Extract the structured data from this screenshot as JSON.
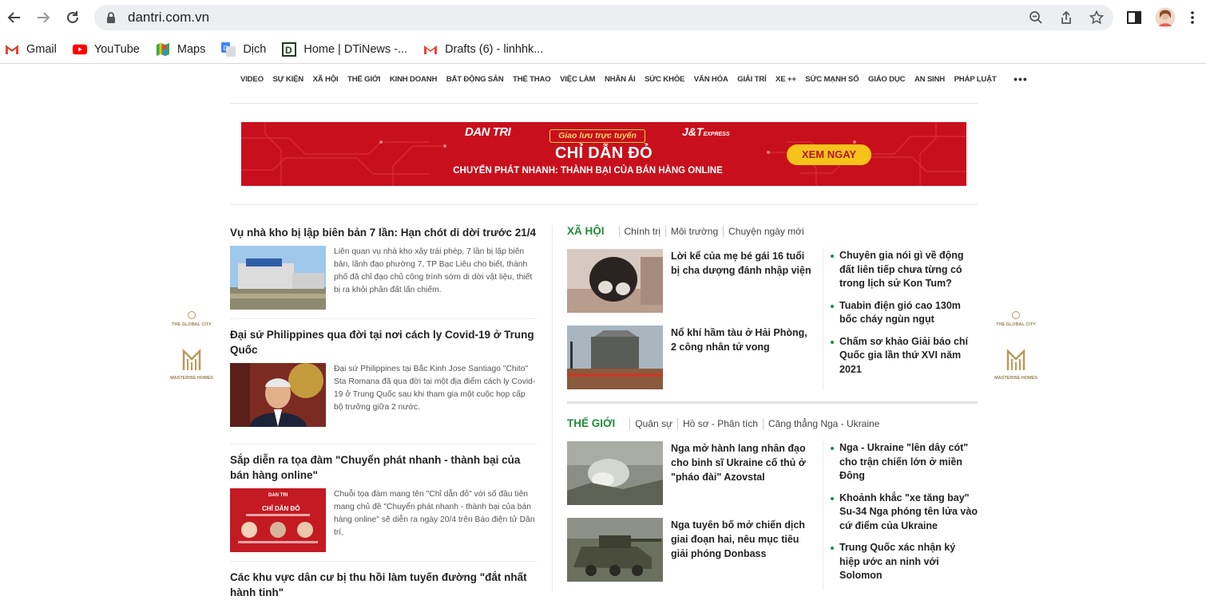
{
  "browser": {
    "url": "dantri.com.vn",
    "bookmarks": [
      {
        "label": "Gmail",
        "icon": "gmail-icon"
      },
      {
        "label": "YouTube",
        "icon": "youtube-icon"
      },
      {
        "label": "Maps",
        "icon": "maps-icon"
      },
      {
        "label": "Dịch",
        "icon": "translate-icon"
      },
      {
        "label": "Home | DTiNews -...",
        "icon": "dtinews-icon"
      },
      {
        "label": "Drafts (6) - linhhk...",
        "icon": "gmail-icon"
      }
    ]
  },
  "nav": {
    "categories": [
      "VIDEO",
      "SỰ KIỆN",
      "XÃ HỘI",
      "THẾ GIỚI",
      "KINH DOANH",
      "BẤT ĐỘNG SẢN",
      "THỂ THAO",
      "VIỆC LÀM",
      "NHÂN ÁI",
      "SỨC KHỎE",
      "VĂN HÓA",
      "GIẢI TRÍ",
      "XE ++",
      "SỨC MẠNH SỐ",
      "GIÁO DỤC",
      "AN SINH",
      "PHÁP LUẬT"
    ],
    "more": "•••"
  },
  "banner": {
    "brand": "DAN TRI",
    "partner": "J&T",
    "partner_small": "EXPRESS",
    "tag": "Giao lưu trực tuyến",
    "title": "CHỈ DẪN ĐỎ",
    "subtitle": "CHUYỂN PHÁT NHANH: THÀNH BẠI CỦA BÁN HÀNG ONLINE",
    "button": "XEM NGAY"
  },
  "side_ads": {
    "city": "THE GLOBAL CITY",
    "brand": "MASTERISE HOMES"
  },
  "left_articles": [
    {
      "title": "Vụ nhà kho bị lập biên bản 7 lần: Hạn chót di dời trước 21/4",
      "summary": "Liên quan vụ nhà kho xây trái phép, 7 lần bị lập biên bản, lãnh đạo phường 7, TP Bạc Liêu cho biết, thành phố đã chỉ đạo chủ công trình sớm di dời vật liệu, thiết bị ra khỏi phần đất lấn chiếm."
    },
    {
      "title": "Đại sứ Philippines qua đời tại nơi cách ly Covid-19 ở Trung Quốc",
      "summary": "Đại sứ Philippines tại Bắc Kinh Jose Santiago \"Chito\" Sta Romana đã qua đời tại một địa điểm cách ly Covid-19 ở Trung Quốc sau khi tham gia một cuộc họp cấp bộ trưởng giữa 2 nước."
    },
    {
      "title": "Sắp diễn ra tọa đàm \"Chuyển phát nhanh - thành bại của bán hàng online\"",
      "summary": "Chuỗi tọa đàm mang tên \"Chỉ dẫn đỏ\" với số đầu tiên mang chủ đề \"Chuyển phát nhanh - thành bại của bán hàng online\" sẽ diễn ra ngày 20/4 trên Báo điện tử Dân trí."
    },
    {
      "title": "Các khu vực dân cư bị thu hồi làm tuyến đường \"đắt nhất hành tinh\"",
      "summary": ""
    }
  ],
  "xa_hoi": {
    "name": "XÃ HỘI",
    "subs": [
      "Chính trị",
      "Môi trường",
      "Chuyện ngày mới"
    ],
    "features": [
      {
        "title": "Lời kể của mẹ bé gái 16 tuổi bị cha dượng đánh nhập viện"
      },
      {
        "title": "Nổ khí hầm tàu ở Hải Phòng, 2 công nhân tử vong"
      }
    ],
    "bullets": [
      "Chuyên gia nói gì về động đất liên tiếp chưa từng có trong lịch sử Kon Tum?",
      "Tuabin điện gió cao 130m bốc cháy ngùn ngụt",
      "Chấm sơ khảo Giải báo chí Quốc gia lần thứ XVI năm 2021"
    ]
  },
  "the_gioi": {
    "name": "THẾ GIỚI",
    "subs": [
      "Quân sự",
      "Hồ sơ - Phân tích",
      "Căng thẳng Nga - Ukraine"
    ],
    "features": [
      {
        "title": "Nga mở hành lang nhân đạo cho binh sĩ Ukraine cố thủ ở \"pháo đài\" Azovstal"
      },
      {
        "title": "Nga tuyên bố mở chiến dịch giai đoạn hai, nêu mục tiêu giải phóng Donbass"
      }
    ],
    "bullets": [
      "Nga - Ukraine \"lên dây cót\" cho trận chiến lớn ở miền Đông",
      "Khoảnh khắc \"xe tăng bay\" Su-34 Nga phóng tên lửa vào cứ điểm của Ukraine",
      "Trung Quốc xác nhận ký hiệp ước an ninh với Solomon"
    ]
  },
  "colors": {
    "accent_green": "#1f8b3a",
    "banner_red": "#c8101c",
    "button_yellow": "#f7c31a"
  }
}
